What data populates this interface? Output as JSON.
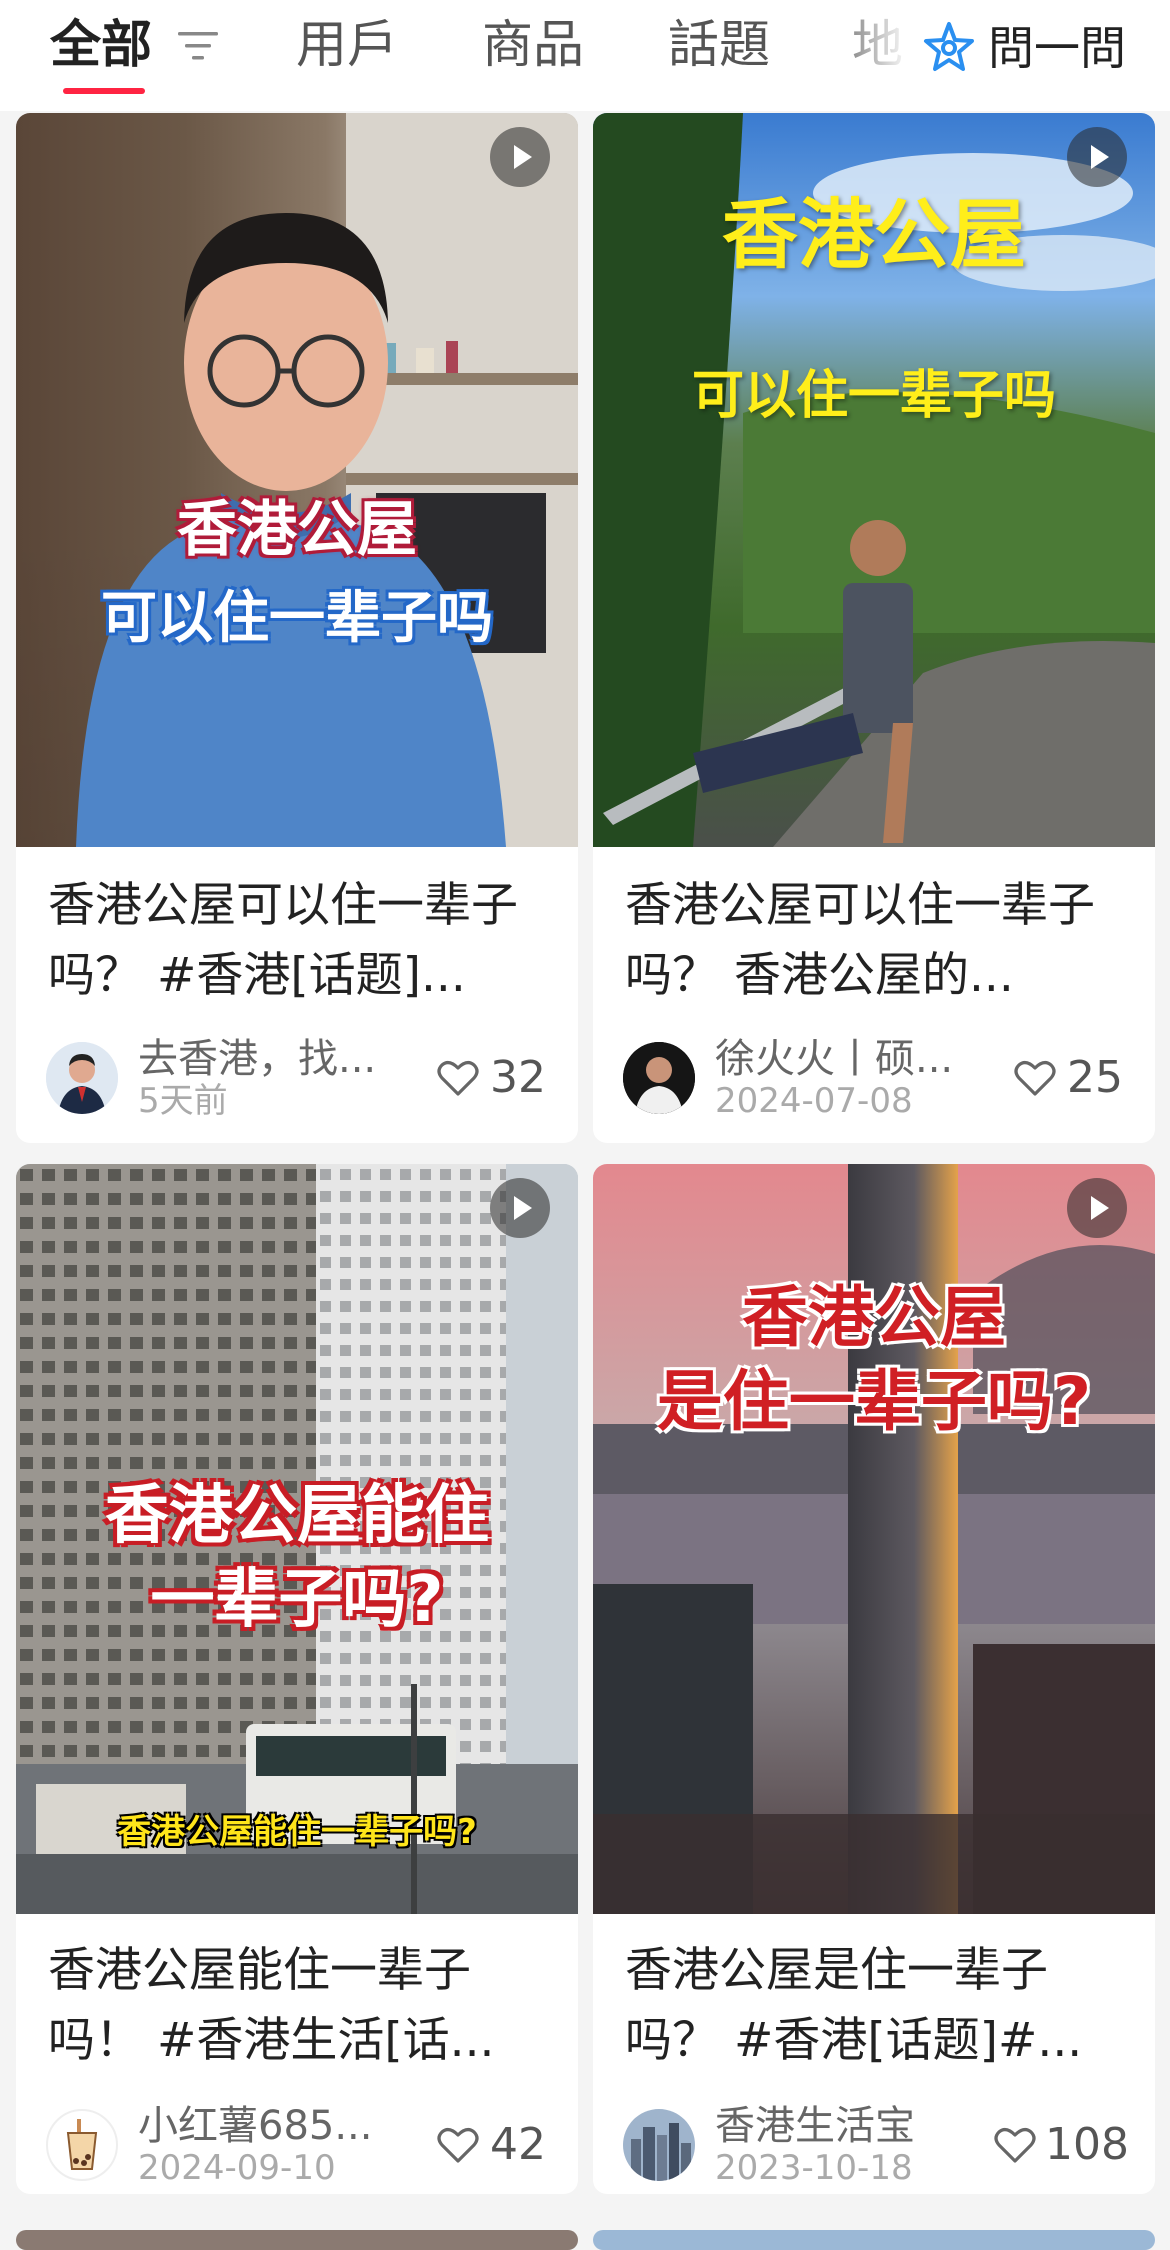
{
  "tabs": [
    {
      "label": "全部",
      "active": true
    },
    {
      "label": "用戶"
    },
    {
      "label": "商品"
    },
    {
      "label": "話題"
    },
    {
      "label": "地"
    }
  ],
  "ask_button": {
    "label": "問一問"
  },
  "cards": [
    {
      "cover_lines": [
        "香港公屋",
        "可以住一辈子吗"
      ],
      "title": "香港公屋可以住一辈子吗？ #香港[话题]...",
      "author": "去香港，找...",
      "date": "5天前",
      "likes": "32",
      "avatar": "avatar-man-suit",
      "video": true
    },
    {
      "cover_lines": [
        "香港公屋",
        "可以住一辈子吗"
      ],
      "title": "香港公屋可以住一辈子吗？ 香港公屋的...",
      "author": "徐火火丨硕...",
      "date": "2024-07-08",
      "likes": "25",
      "avatar": "avatar-man-dark",
      "video": true
    },
    {
      "cover_lines": [
        "香港公屋能住",
        "一辈子吗?",
        "香港公屋能住一辈子吗?"
      ],
      "title": "香港公屋能住一辈子吗！ #香港生活[话...",
      "author": "小红薯685...",
      "date": "2024-09-10",
      "likes": "42",
      "avatar": "avatar-bubble-tea",
      "video": true
    },
    {
      "cover_lines": [
        "香港公屋",
        "是住一辈子吗?"
      ],
      "title": "香港公屋是住一辈子吗？ #香港[话题]#...",
      "author": "香港生活宝",
      "date": "2023-10-18",
      "likes": "108",
      "avatar": "avatar-city",
      "video": true
    }
  ],
  "colors": {
    "accent": "#ff2442",
    "ask_icon": "#2a8ff0"
  }
}
